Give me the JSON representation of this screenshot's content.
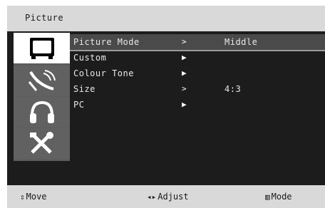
{
  "header": {
    "title": "Picture"
  },
  "sidebar": {
    "icons": [
      {
        "name": "tv-screen-icon",
        "active": true
      },
      {
        "name": "antenna-icon",
        "active": false
      },
      {
        "name": "headphones-icon",
        "active": false
      },
      {
        "name": "tools-icon",
        "active": false
      }
    ]
  },
  "menu": {
    "items": [
      {
        "label": "Picture Mode",
        "arrow": ">",
        "value": "Middle"
      },
      {
        "label": "Custom",
        "arrow": "▶",
        "value": ""
      },
      {
        "label": "Colour Tone",
        "arrow": "▶",
        "value": ""
      },
      {
        "label": "Size",
        "arrow": ">",
        "value": "4:3"
      },
      {
        "label": "PC",
        "arrow": "▶",
        "value": ""
      }
    ]
  },
  "footer": {
    "move": {
      "glyph": "⇕",
      "label": "Move"
    },
    "adjust": {
      "glyph": "◂▸",
      "label": "Adjust"
    },
    "mode": {
      "glyph": "▥",
      "label": "Mode"
    }
  },
  "colors": {
    "osd_background": "#1c1c1c",
    "bar_background": "#d9d9d9",
    "selection": "#4a4a4a"
  }
}
